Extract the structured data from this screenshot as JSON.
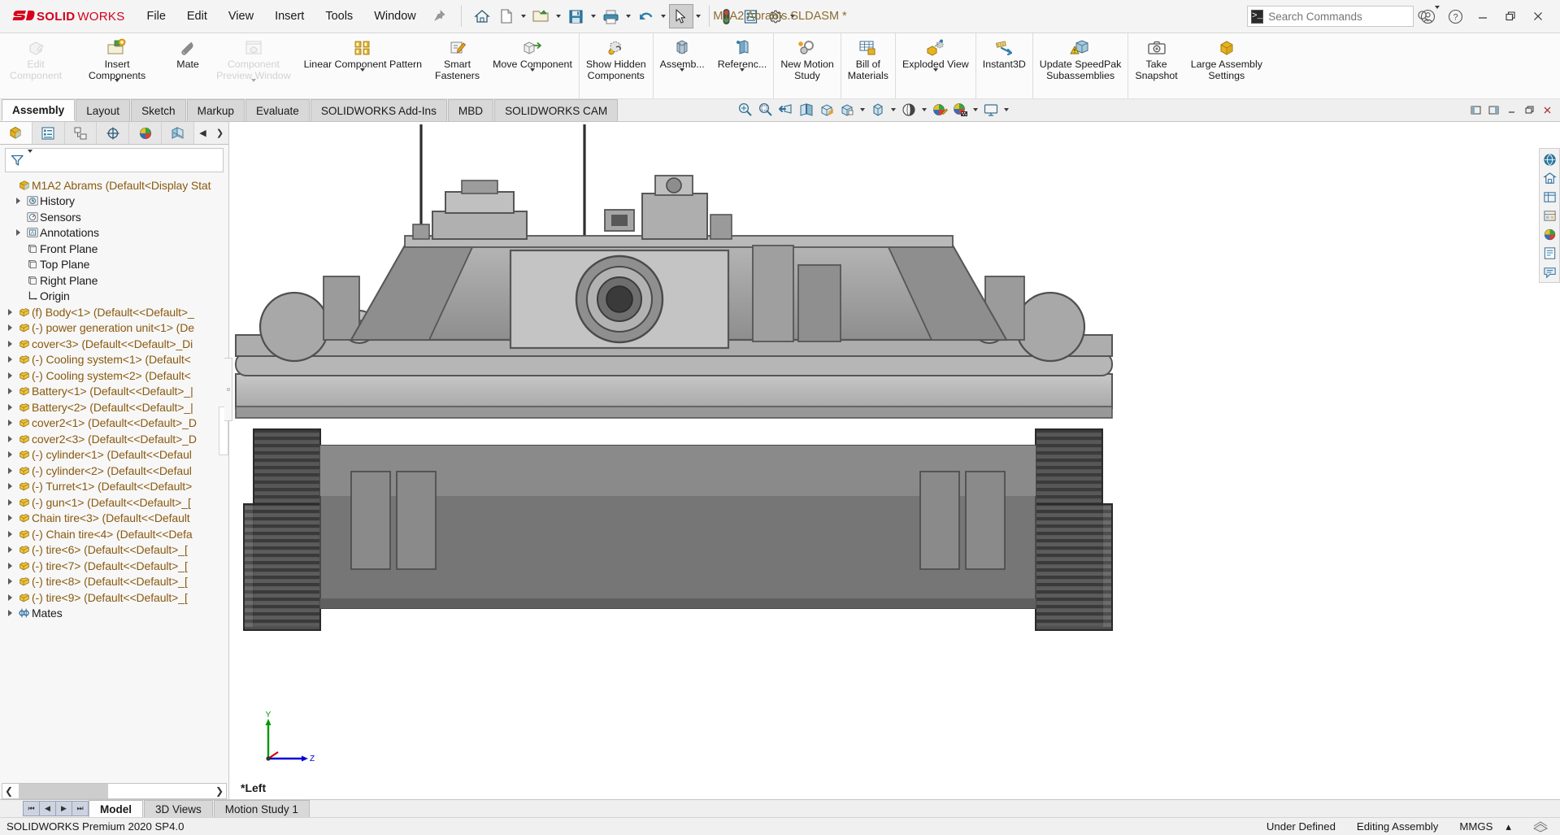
{
  "app": {
    "brand_mark": "DS",
    "brand_solid": "SOLID",
    "brand_works": "WORKS",
    "document_title": "M1A2 Abrams.SLDASM *",
    "accent_color": "#d6001c",
    "title_color": "#8a6d2f"
  },
  "menubar": {
    "items": [
      {
        "label": "File"
      },
      {
        "label": "Edit"
      },
      {
        "label": "View"
      },
      {
        "label": "Insert"
      },
      {
        "label": "Tools"
      },
      {
        "label": "Window"
      }
    ],
    "pin_icon": "pushpin-icon"
  },
  "quick_access": {
    "buttons": [
      {
        "name": "home-icon",
        "label": "Home",
        "caret": false
      },
      {
        "name": "new-document-icon",
        "label": "New",
        "caret": true
      },
      {
        "name": "open-folder-icon",
        "label": "Open",
        "caret": true
      },
      {
        "name": "save-icon",
        "label": "Save",
        "caret": true
      },
      {
        "name": "print-icon",
        "label": "Print",
        "caret": true
      },
      {
        "name": "undo-icon",
        "label": "Undo",
        "caret": true
      },
      {
        "name": "select-cursor-icon",
        "label": "Select",
        "caret": true
      },
      {
        "name": "rebuild-icon",
        "label": "Rebuild",
        "caret": false
      },
      {
        "name": "file-properties-icon",
        "label": "File Properties",
        "caret": false
      },
      {
        "name": "options-gear-icon",
        "label": "Options",
        "caret": true
      }
    ]
  },
  "search": {
    "placeholder": "Search Commands",
    "value": "",
    "icon": "search-icon",
    "prefix_icon": "command-prompt-icon"
  },
  "window_controls": {
    "account": "user-account-icon",
    "help": "help-question-icon",
    "minimize": "minimize-icon",
    "restore": "restore-window-icon",
    "close": "close-icon"
  },
  "ribbon": {
    "groups": [
      {
        "buttons": [
          {
            "label": "Edit\nComponent",
            "icon": "edit-component-icon",
            "disabled": true,
            "caret": false
          },
          {
            "label": "Insert Components",
            "icon": "insert-components-icon",
            "disabled": false,
            "caret": true
          },
          {
            "label": "Mate",
            "icon": "mate-paperclip-icon",
            "disabled": false,
            "caret": false
          },
          {
            "label": "Component\nPreview Window",
            "icon": "component-preview-icon",
            "disabled": true,
            "caret": true
          },
          {
            "label": "Linear Component Pattern",
            "icon": "linear-pattern-icon",
            "disabled": false,
            "caret": true
          },
          {
            "label": "Smart\nFasteners",
            "icon": "smart-fasteners-icon",
            "disabled": false,
            "caret": false
          },
          {
            "label": "Move Component",
            "icon": "move-component-icon",
            "disabled": false,
            "caret": true
          }
        ]
      },
      {
        "buttons": [
          {
            "label": "Show Hidden\nComponents",
            "icon": "show-hidden-components-icon",
            "disabled": false,
            "caret": false
          }
        ]
      },
      {
        "buttons": [
          {
            "label": "Assemb...",
            "icon": "assembly-features-icon",
            "disabled": false,
            "caret": true
          },
          {
            "label": "Referenc...",
            "icon": "reference-geometry-icon",
            "disabled": false,
            "caret": true
          }
        ]
      },
      {
        "buttons": [
          {
            "label": "New Motion\nStudy",
            "icon": "new-motion-study-icon",
            "disabled": false,
            "caret": false
          }
        ]
      },
      {
        "buttons": [
          {
            "label": "Bill of\nMaterials",
            "icon": "bill-of-materials-icon",
            "disabled": false,
            "caret": false
          }
        ]
      },
      {
        "buttons": [
          {
            "label": "Exploded View",
            "icon": "exploded-view-icon",
            "disabled": false,
            "caret": true
          }
        ]
      },
      {
        "buttons": [
          {
            "label": "Instant3D",
            "icon": "instant3d-icon",
            "disabled": false,
            "caret": false
          }
        ]
      },
      {
        "buttons": [
          {
            "label": "Update SpeedPak\nSubassemblies",
            "icon": "update-speedpak-icon",
            "disabled": false,
            "caret": false
          }
        ]
      },
      {
        "buttons": [
          {
            "label": "Take\nSnapshot",
            "icon": "take-snapshot-camera-icon",
            "disabled": false,
            "caret": false
          },
          {
            "label": "Large Assembly\nSettings",
            "icon": "large-assembly-settings-icon",
            "disabled": false,
            "caret": false
          }
        ]
      }
    ]
  },
  "command_tabs": {
    "items": [
      {
        "label": "Assembly",
        "active": true
      },
      {
        "label": "Layout",
        "active": false
      },
      {
        "label": "Sketch",
        "active": false
      },
      {
        "label": "Markup",
        "active": false
      },
      {
        "label": "Evaluate",
        "active": false
      },
      {
        "label": "SOLIDWORKS Add-Ins",
        "active": false
      },
      {
        "label": "MBD",
        "active": false
      },
      {
        "label": "SOLIDWORKS CAM",
        "active": false
      }
    ]
  },
  "heads_up_view": {
    "buttons": [
      {
        "name": "zoom-to-fit-icon",
        "caret": false
      },
      {
        "name": "zoom-to-area-icon",
        "caret": false
      },
      {
        "name": "previous-view-icon",
        "caret": false
      },
      {
        "name": "section-view-icon",
        "caret": false
      },
      {
        "name": "view-orientation-icon",
        "caret": false
      },
      {
        "name": "display-style-icon",
        "caret": true
      },
      {
        "name": "hide-show-items-icon",
        "caret": true
      },
      {
        "name": "edit-appearance-icon",
        "caret": true
      },
      {
        "name": "apply-scene-icon",
        "caret": true
      },
      {
        "name": "view-settings-icon",
        "caret": true
      }
    ],
    "window_buttons": [
      {
        "name": "tile-left-icon"
      },
      {
        "name": "tile-right-icon"
      },
      {
        "name": "minimize-doc-icon"
      },
      {
        "name": "restore-doc-icon"
      },
      {
        "name": "close-doc-icon"
      }
    ]
  },
  "feature_manager": {
    "tabs": [
      {
        "name": "feature-tree-tab",
        "icon": "assembly-tree-icon",
        "active": true
      },
      {
        "name": "property-manager-tab",
        "icon": "property-list-icon",
        "active": false
      },
      {
        "name": "configuration-manager-tab",
        "icon": "configuration-icon",
        "active": false
      },
      {
        "name": "dimxpert-manager-tab",
        "icon": "dimxpert-icon",
        "active": false
      },
      {
        "name": "display-manager-tab",
        "icon": "display-palette-icon",
        "active": false
      },
      {
        "name": "cam-manager-tab",
        "icon": "cam-feature-icon",
        "active": false
      }
    ],
    "nav_prev": "◀",
    "nav_next": "❯",
    "filter": {
      "icon": "filter-funnel-icon",
      "placeholder": "",
      "value": ""
    },
    "tree": [
      {
        "label": "M1A2 Abrams  (Default<Display Stat",
        "icon": "assembly-root-icon",
        "indent": 0,
        "expandable": false,
        "color": "orange"
      },
      {
        "label": "History",
        "icon": "history-folder-icon",
        "indent": 1,
        "expandable": true,
        "color": "dark"
      },
      {
        "label": "Sensors",
        "icon": "sensors-icon",
        "indent": 1,
        "expandable": false,
        "color": "dark"
      },
      {
        "label": "Annotations",
        "icon": "annotations-icon",
        "indent": 1,
        "expandable": true,
        "color": "dark"
      },
      {
        "label": "Front Plane",
        "icon": "plane-icon",
        "indent": 1,
        "expandable": false,
        "color": "dark"
      },
      {
        "label": "Top Plane",
        "icon": "plane-icon",
        "indent": 1,
        "expandable": false,
        "color": "dark"
      },
      {
        "label": "Right Plane",
        "icon": "plane-icon",
        "indent": 1,
        "expandable": false,
        "color": "dark"
      },
      {
        "label": "Origin",
        "icon": "origin-icon",
        "indent": 1,
        "expandable": false,
        "color": "dark"
      },
      {
        "label": "(f) Body<1> (Default<<Default>_",
        "icon": "component-icon",
        "indent": 1,
        "expandable": true,
        "color": "orange"
      },
      {
        "label": "(-) power generation unit<1> (De",
        "icon": "component-icon",
        "indent": 1,
        "expandable": true,
        "color": "orange"
      },
      {
        "label": "cover<3> (Default<<Default>_Di",
        "icon": "component-icon",
        "indent": 1,
        "expandable": true,
        "color": "orange"
      },
      {
        "label": "(-) Cooling system<1> (Default<",
        "icon": "component-icon",
        "indent": 1,
        "expandable": true,
        "color": "orange"
      },
      {
        "label": "(-) Cooling system<2> (Default<",
        "icon": "component-icon",
        "indent": 1,
        "expandable": true,
        "color": "orange"
      },
      {
        "label": "Battery<1> (Default<<Default>_|",
        "icon": "component-icon",
        "indent": 1,
        "expandable": true,
        "color": "orange"
      },
      {
        "label": "Battery<2> (Default<<Default>_|",
        "icon": "component-icon",
        "indent": 1,
        "expandable": true,
        "color": "orange"
      },
      {
        "label": "cover2<1> (Default<<Default>_D",
        "icon": "component-icon",
        "indent": 1,
        "expandable": true,
        "color": "orange"
      },
      {
        "label": "cover2<3> (Default<<Default>_D",
        "icon": "component-icon",
        "indent": 1,
        "expandable": true,
        "color": "orange"
      },
      {
        "label": "(-) cylinder<1> (Default<<Defaul",
        "icon": "component-icon",
        "indent": 1,
        "expandable": true,
        "color": "orange"
      },
      {
        "label": "(-) cylinder<2> (Default<<Defaul",
        "icon": "component-icon",
        "indent": 1,
        "expandable": true,
        "color": "orange"
      },
      {
        "label": "(-) Turret<1> (Default<<Default>",
        "icon": "component-icon",
        "indent": 1,
        "expandable": true,
        "color": "orange"
      },
      {
        "label": "(-) gun<1> (Default<<Default>_[",
        "icon": "component-icon",
        "indent": 1,
        "expandable": true,
        "color": "orange"
      },
      {
        "label": "Chain tire<3> (Default<<Default",
        "icon": "component-icon",
        "indent": 1,
        "expandable": true,
        "color": "orange"
      },
      {
        "label": "(-) Chain tire<4> (Default<<Defa",
        "icon": "component-icon",
        "indent": 1,
        "expandable": true,
        "color": "orange"
      },
      {
        "label": "(-) tire<6> (Default<<Default>_[",
        "icon": "component-icon",
        "indent": 1,
        "expandable": true,
        "color": "orange"
      },
      {
        "label": "(-) tire<7> (Default<<Default>_[",
        "icon": "component-icon",
        "indent": 1,
        "expandable": true,
        "color": "orange"
      },
      {
        "label": "(-) tire<8> (Default<<Default>_[",
        "icon": "component-icon",
        "indent": 1,
        "expandable": true,
        "color": "orange"
      },
      {
        "label": "(-) tire<9> (Default<<Default>_[",
        "icon": "component-icon",
        "indent": 1,
        "expandable": true,
        "color": "orange"
      },
      {
        "label": "Mates",
        "icon": "mates-folder-icon",
        "indent": 1,
        "expandable": true,
        "color": "dark"
      }
    ]
  },
  "graphics": {
    "view_label": "*Left",
    "model_name": "M1A2 Abrams",
    "triad": {
      "y_label": "Y",
      "z_label": "Z",
      "x_color": "#d40000",
      "y_color": "#009a00",
      "z_color": "#0000d4"
    }
  },
  "task_pane": {
    "buttons": [
      {
        "name": "solidworks-resources-icon"
      },
      {
        "name": "design-library-icon"
      },
      {
        "name": "file-explorer-icon"
      },
      {
        "name": "view-palette-icon"
      },
      {
        "name": "appearances-scenes-icon"
      },
      {
        "name": "custom-properties-icon"
      },
      {
        "name": "solidworks-forum-icon"
      }
    ]
  },
  "bottom_tabs": {
    "nav": [
      "⏮",
      "◀",
      "▶",
      "⏭"
    ],
    "items": [
      {
        "label": "Model",
        "active": true
      },
      {
        "label": "3D Views",
        "active": false
      },
      {
        "label": "Motion Study 1",
        "active": false
      }
    ]
  },
  "status_bar": {
    "left": "SOLIDWORKS Premium 2020 SP4.0",
    "state": "Under Defined",
    "mode": "Editing Assembly",
    "units": "MMGS",
    "units_caret": "▴",
    "overlay_icon": "sheet-stack-icon"
  },
  "panel_scroll": {
    "left_arrow": "❮",
    "right_arrow": "❯"
  }
}
